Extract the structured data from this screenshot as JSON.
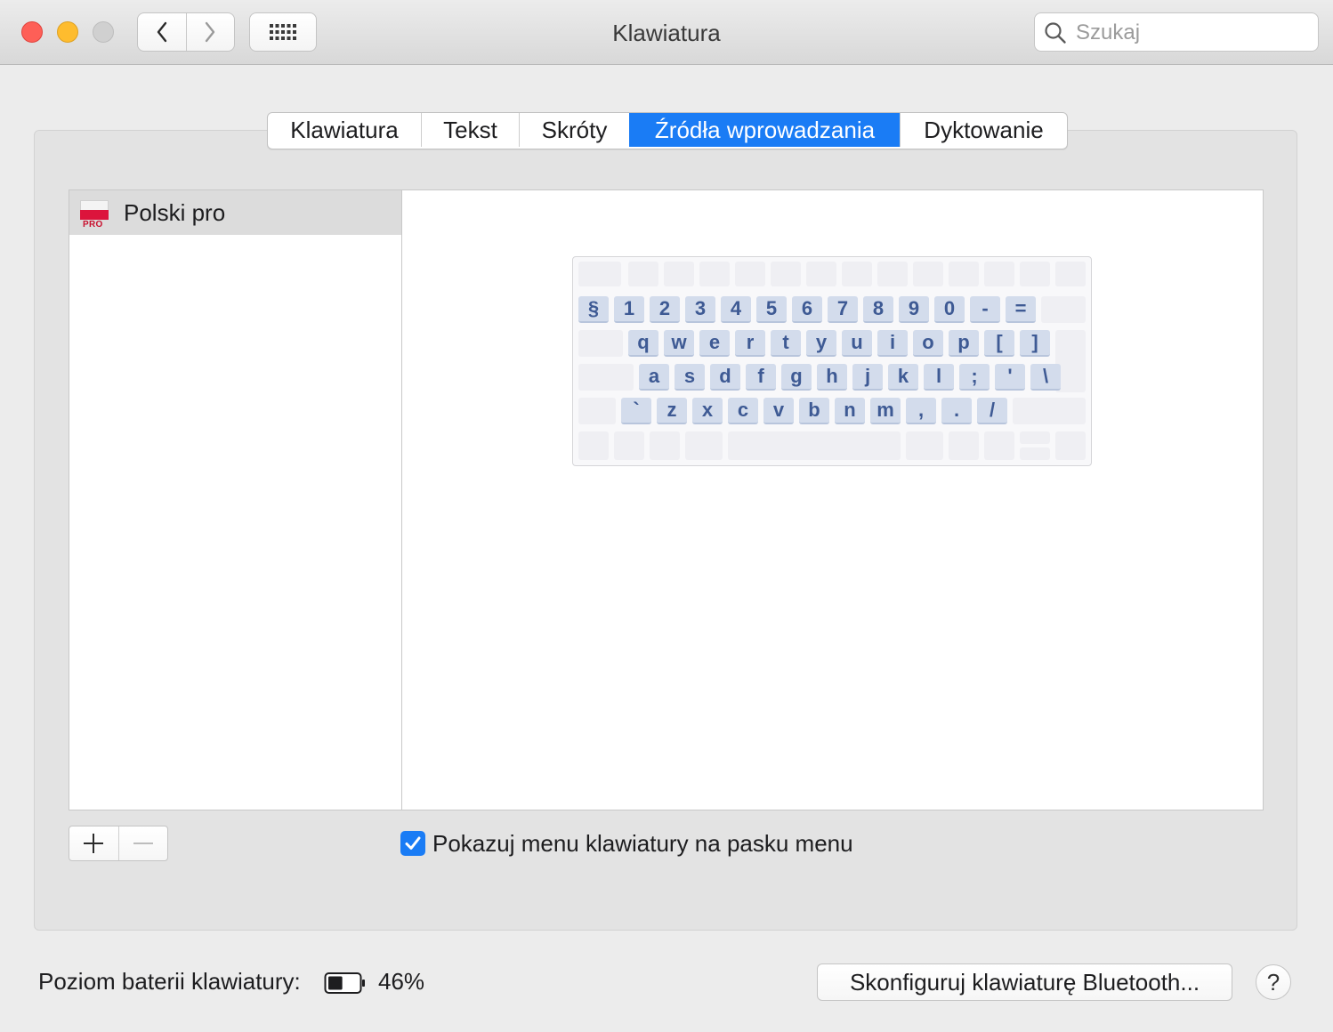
{
  "window": {
    "title": "Klawiatura",
    "search_placeholder": "Szukaj"
  },
  "tabs": [
    {
      "label": "Klawiatura",
      "active": false
    },
    {
      "label": "Tekst",
      "active": false
    },
    {
      "label": "Skróty",
      "active": false
    },
    {
      "label": "Źródła wprowadzania",
      "active": true
    },
    {
      "label": "Dyktowanie",
      "active": false
    }
  ],
  "input_sources": [
    {
      "label": "Polski pro",
      "flag_badge": "PRO",
      "selected": true
    }
  ],
  "keyboard": {
    "row_numbers": [
      "§",
      "1",
      "2",
      "3",
      "4",
      "5",
      "6",
      "7",
      "8",
      "9",
      "0",
      "-",
      "="
    ],
    "row_top": [
      "q",
      "w",
      "e",
      "r",
      "t",
      "y",
      "u",
      "i",
      "o",
      "p",
      "[",
      "]"
    ],
    "row_home": [
      "a",
      "s",
      "d",
      "f",
      "g",
      "h",
      "j",
      "k",
      "l",
      ";",
      "'",
      "\\"
    ],
    "row_bottom": [
      "`",
      "z",
      "x",
      "c",
      "v",
      "b",
      "n",
      "m",
      ",",
      ".",
      "/"
    ]
  },
  "options": {
    "show_menu_label": "Pokazuj menu klawiatury na pasku menu",
    "show_menu_checked": true
  },
  "footer": {
    "battery_label": "Poziom baterii klawiatury:",
    "battery_percent": "46%",
    "battery_level": 0.46,
    "bluetooth_button": "Skonfiguruj klawiaturę Bluetooth...",
    "help_label": "?"
  },
  "colors": {
    "accent": "#1a7cf5",
    "key_fill": "#d3dcec",
    "key_text": "#3e5a94"
  }
}
